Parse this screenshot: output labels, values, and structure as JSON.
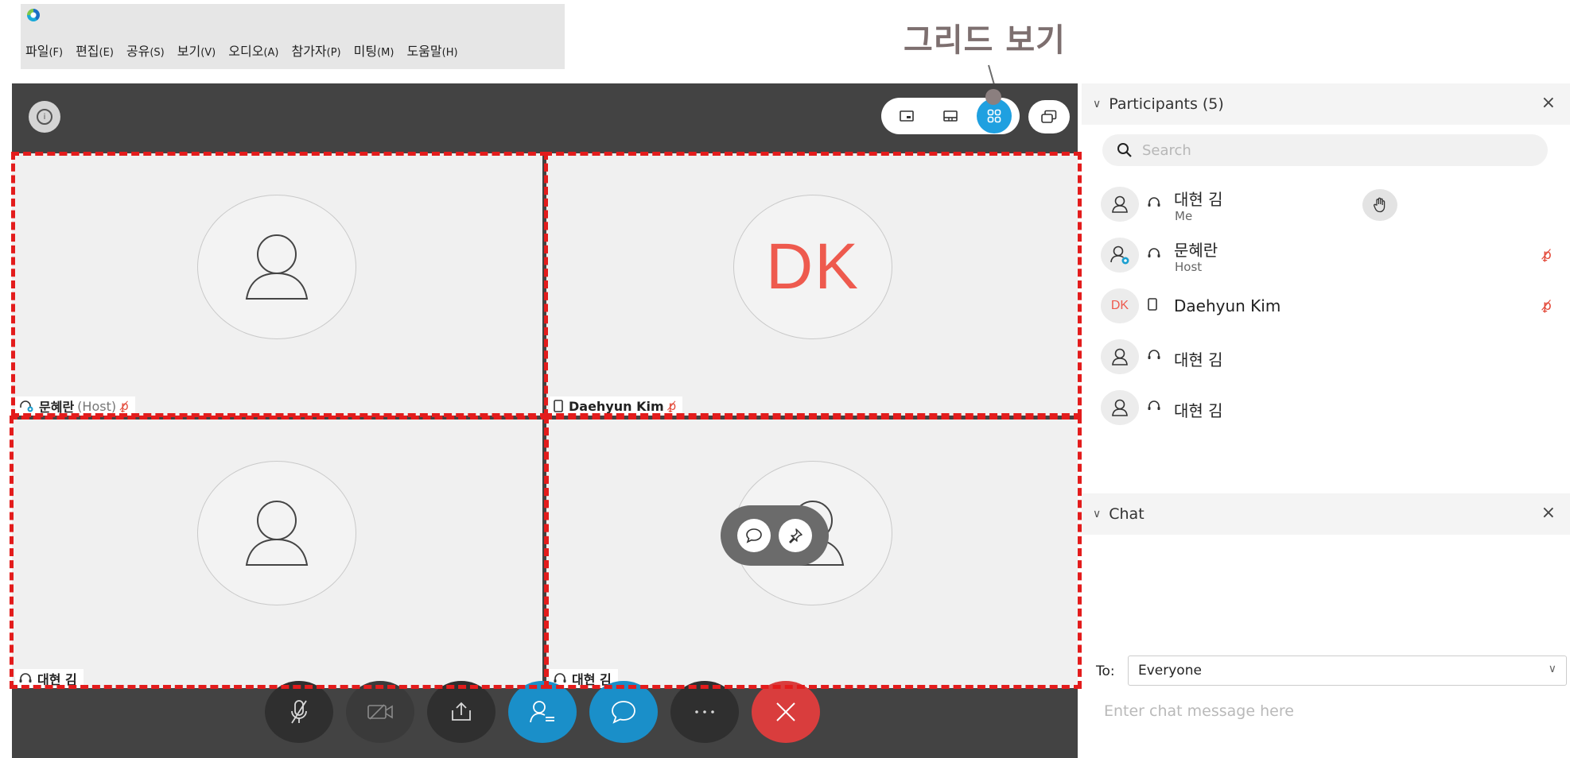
{
  "menubar": {
    "items": [
      {
        "label": "파일",
        "accel": "(F)"
      },
      {
        "label": "편집",
        "accel": "(E)"
      },
      {
        "label": "공유",
        "accel": "(S)"
      },
      {
        "label": "보기",
        "accel": "(V)"
      },
      {
        "label": "오디오",
        "accel": "(A)"
      },
      {
        "label": "참가자",
        "accel": "(P)"
      },
      {
        "label": "미팅",
        "accel": "(M)"
      },
      {
        "label": "도움말",
        "accel": "(H)"
      }
    ]
  },
  "annotation": {
    "text": "그리드 보기"
  },
  "tiles": [
    {
      "name": "문혜란",
      "role": "(Host)",
      "avatar_initials": "",
      "device": "headset",
      "muted": true
    },
    {
      "name": "Daehyun Kim",
      "role": "",
      "avatar_initials": "DK",
      "device": "phone",
      "muted": true
    },
    {
      "name": "대현 김",
      "role": "",
      "avatar_initials": "",
      "device": "headset",
      "muted": false
    },
    {
      "name": "대현 김",
      "role": "",
      "avatar_initials": "",
      "device": "headset",
      "muted": false
    }
  ],
  "participants_panel": {
    "title": "Participants (5)",
    "search_placeholder": "Search",
    "participants": [
      {
        "name": "대현 김",
        "sub": "Me",
        "initials": "",
        "raised_hand": true,
        "muted": false
      },
      {
        "name": "문혜란",
        "sub": "Host",
        "initials": "",
        "raised_hand": false,
        "muted": true
      },
      {
        "name": "Daehyun Kim",
        "sub": "",
        "initials": "DK",
        "raised_hand": false,
        "muted": true
      },
      {
        "name": "대현 김",
        "sub": "",
        "initials": "",
        "raised_hand": false,
        "muted": false
      },
      {
        "name": "대현 김",
        "sub": "",
        "initials": "",
        "raised_hand": false,
        "muted": false
      }
    ]
  },
  "chat_panel": {
    "title": "Chat",
    "to_label": "To:",
    "to_value": "Everyone",
    "input_placeholder": "Enter chat message here"
  },
  "colors": {
    "accent": "#1fa0e0",
    "end_call": "#d93d3d",
    "stage_bg": "#434343",
    "highlight_dash": "#e31c1c",
    "initials": "#ee5a4e"
  }
}
